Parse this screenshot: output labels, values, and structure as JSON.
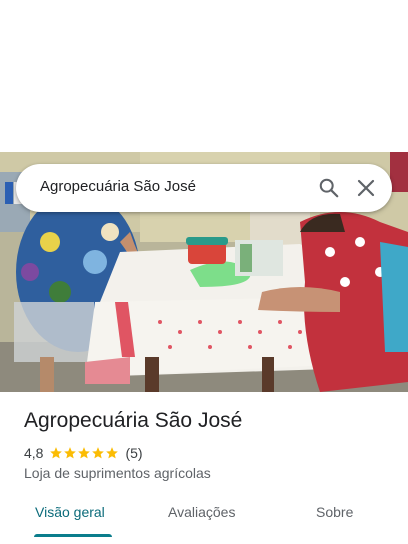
{
  "search": {
    "query": "Agropecuária São José"
  },
  "place": {
    "name": "Agropecuária São José",
    "rating": "4,8",
    "review_count": "(5)",
    "stars": 5,
    "category": "Loja de suprimentos agrícolas"
  },
  "tabs": [
    {
      "label": "Visão geral",
      "active": true
    },
    {
      "label": "Avaliações",
      "active": false
    },
    {
      "label": "Sobre",
      "active": false
    }
  ],
  "colors": {
    "accent": "#0b7d8c",
    "star": "#fbbc04",
    "text": "#202124",
    "secondary_text": "#5f6368"
  },
  "icons": {
    "search": "search-icon",
    "close": "close-icon",
    "star": "star-icon"
  }
}
